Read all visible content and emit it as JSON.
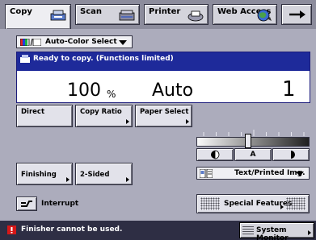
{
  "tabs": {
    "copy": "Copy",
    "scan": "Scan",
    "printer": "Printer",
    "web_access": "Web Access",
    "active": "Copy"
  },
  "color_select": {
    "value": "Auto-Color Select"
  },
  "status": {
    "message": "Ready to copy. (Functions limited)",
    "copy_ratio": "100",
    "copy_ratio_unit": "%",
    "paper": "Auto",
    "quantity": "1"
  },
  "buttons": {
    "direct": "Direct",
    "copy_ratio": "Copy Ratio",
    "paper_select": "Paper Select",
    "finishing": "Finishing",
    "two_sided": "2-Sided",
    "interrupt": "Interrupt",
    "special_features": "Special Features",
    "system_monitor": "System Monitor"
  },
  "density": {
    "auto_label": "A",
    "level_fraction": 0.5
  },
  "original_type": {
    "value": "Text/Printed Img."
  },
  "bottom_status": {
    "message": "Finisher cannot be used."
  },
  "colors": {
    "status_header": "#1e2a9a",
    "warning": "#d81818",
    "panel_bg": "#acacbc",
    "statusbar_bg": "#2e2e44"
  },
  "icons": {
    "copy_tab": "copier-icon",
    "scan_tab": "scanner-icon",
    "printer_tab": "printer-icon",
    "web_tab": "globe-icon",
    "next": "arrow-right-icon",
    "warning": "warning-icon"
  }
}
